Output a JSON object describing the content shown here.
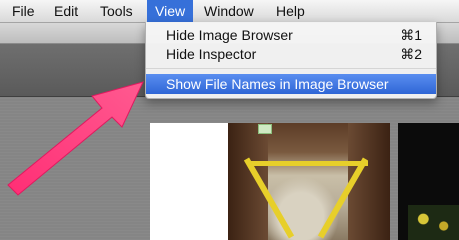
{
  "menubar": {
    "items": [
      {
        "label": "File"
      },
      {
        "label": "Edit"
      },
      {
        "label": "Tools"
      },
      {
        "label": "View"
      },
      {
        "label": "Window"
      },
      {
        "label": "Help"
      }
    ],
    "active_item": "View"
  },
  "view_menu": {
    "items": [
      {
        "label": "Hide Image Browser",
        "shortcut": "⌘1"
      },
      {
        "label": "Hide Inspector",
        "shortcut": "⌘2"
      },
      {
        "label": "Show File Names in Image Browser",
        "shortcut": ""
      }
    ],
    "highlighted_item": "Show File Names in Image Browser"
  },
  "colors": {
    "menu_highlight": "#3670d9",
    "annotation_arrow": "#ff3f7f"
  }
}
